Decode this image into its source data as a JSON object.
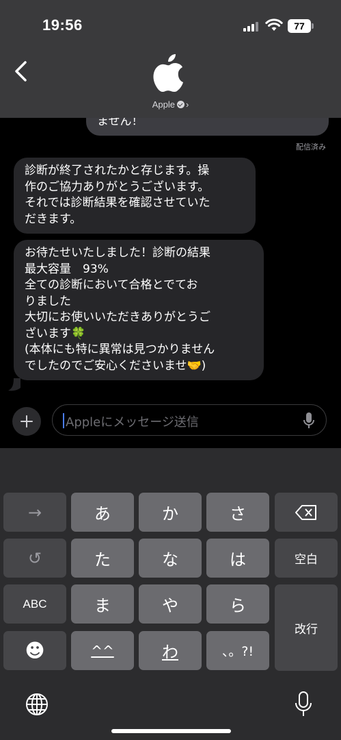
{
  "status_bar": {
    "time": "19:56",
    "battery": "77"
  },
  "header": {
    "contact_name": "Apple"
  },
  "messages": {
    "sent_fragment": "ません！",
    "delivered_label": "配信済み",
    "received": [
      [
        "診断が終了されたかと存じます。操",
        "作のご協力ありがとうございます。",
        "それでは診断結果を確認させていた",
        "だきます。"
      ],
      [
        "お待たせいたしました！診断の結果",
        "最大容量　93%",
        "全ての診断において合格とでてお",
        "りました",
        "大切にお使いいただきありがとうご",
        "ざいます🍀",
        "(本体にも特に異常は見つかりません",
        "でしたのでご安心くださいませ🤝)"
      ]
    ]
  },
  "input": {
    "placeholder": "Appleにメッセージ送信"
  },
  "keyboard": {
    "rows": [
      [
        "→",
        "あ",
        "か",
        "さ",
        "⌫"
      ],
      [
        "↺",
        "た",
        "な",
        "は",
        "空白"
      ],
      [
        "ABC",
        "ま",
        "や",
        "ら",
        "改行"
      ],
      [
        "☻",
        "^^",
        "わ",
        "、。?!"
      ]
    ]
  },
  "colors": {
    "header_bg": "#3a3a3c",
    "bubble_received": "#262629",
    "bubble_sent": "#3d3d42",
    "caret": "#4a7dff"
  }
}
